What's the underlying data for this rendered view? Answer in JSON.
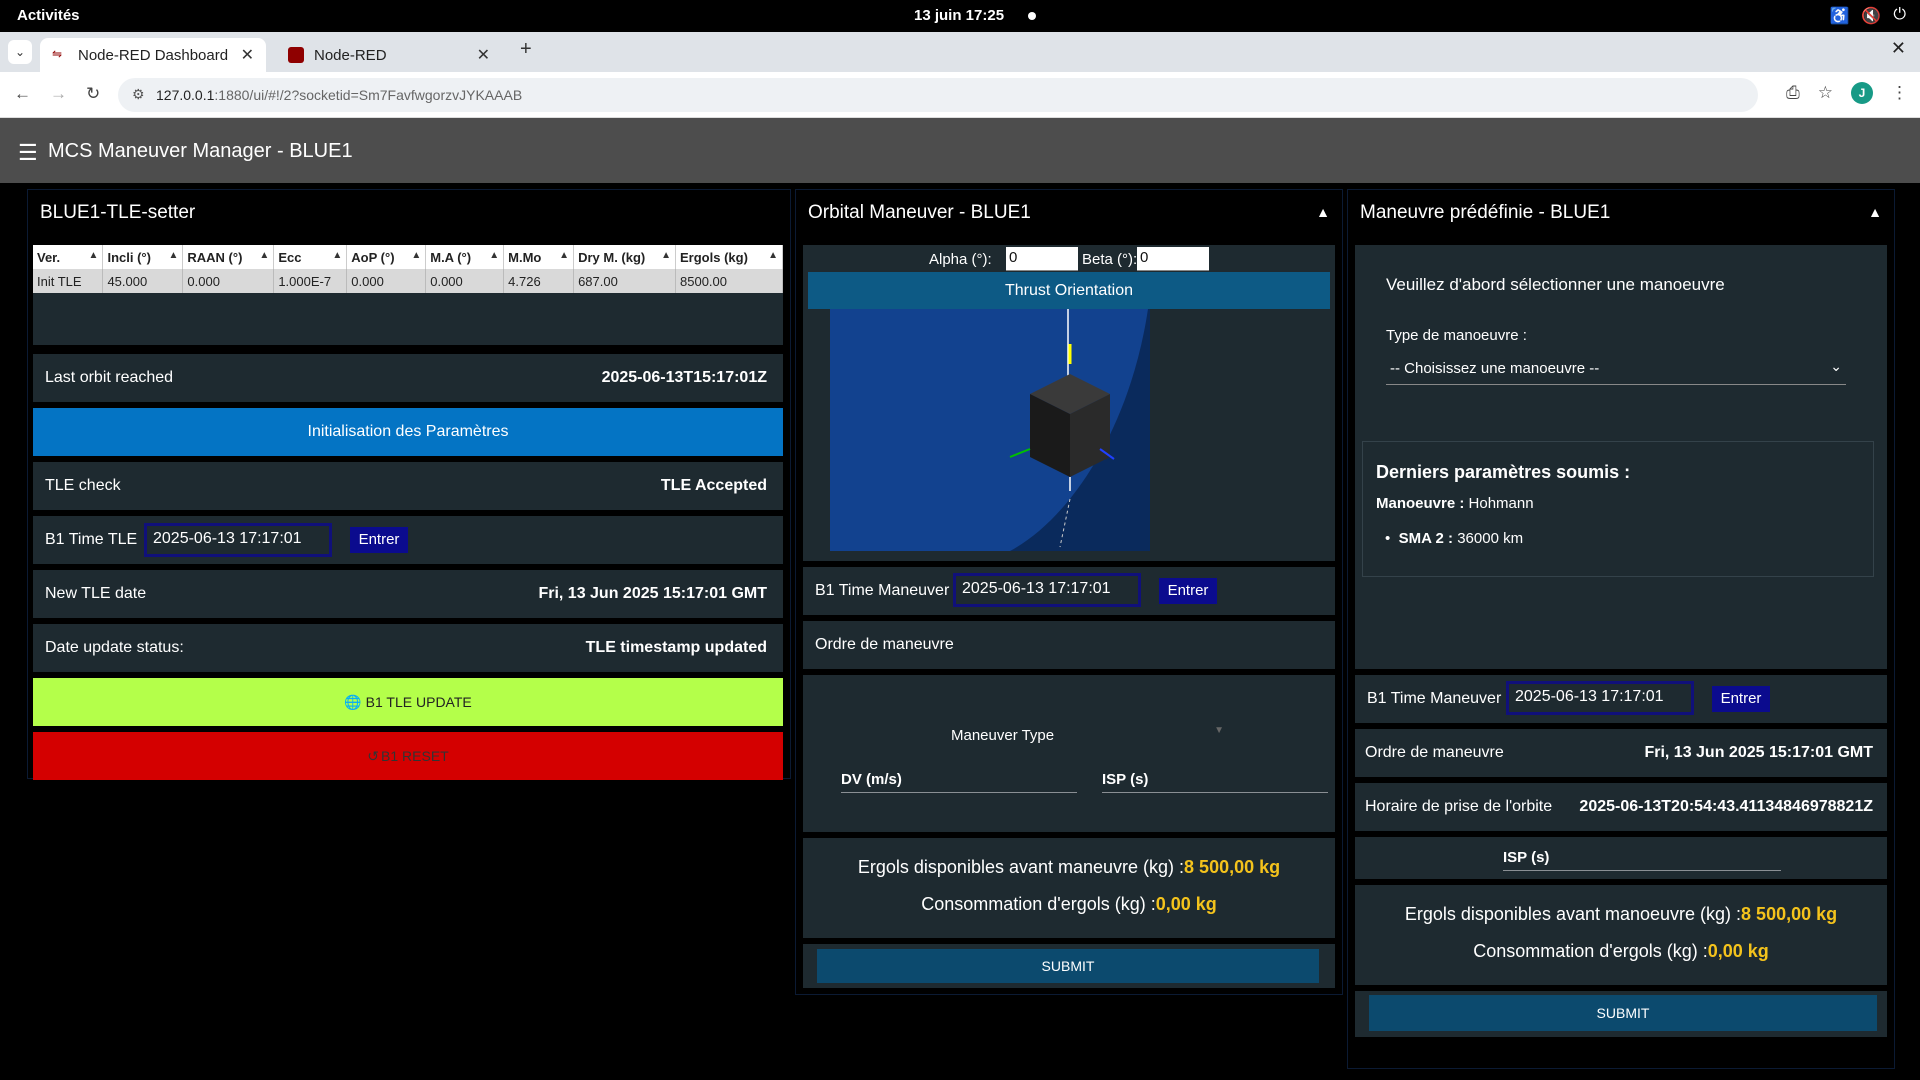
{
  "system": {
    "activities": "Activités",
    "clock": "13 juin  17:25"
  },
  "browser": {
    "tabs": [
      {
        "label": "Node-RED Dashboard",
        "active": true
      },
      {
        "label": "Node-RED",
        "active": false
      }
    ],
    "url_host": "127.0.0.1",
    "url_rest": ":1880/ui/#!/2?socketid=Sm7FavfwgorzvJYKAAAB",
    "profile_initial": "J"
  },
  "app": {
    "title": "MCS Maneuver Manager - BLUE1"
  },
  "tle_setter": {
    "title": "BLUE1-TLE-setter",
    "table": {
      "headers": [
        "Ver.",
        "Incli (°)",
        "RAAN (°)",
        "Ecc",
        "AoP (°)",
        "M.A (°)",
        "M.Mo",
        "Dry M. (kg)",
        "Ergols (kg)"
      ],
      "row": [
        "Init TLE",
        "45.000",
        "0.000",
        "1.000E-7",
        "0.000",
        "0.000",
        "4.726",
        "687.00",
        "8500.00"
      ]
    },
    "last_orbit_label": "Last orbit reached",
    "last_orbit_value": "2025-06-13T15:17:01Z",
    "init_button": "Initialisation des Paramètres",
    "tle_check_label": "TLE check",
    "tle_check_value": "TLE Accepted",
    "time_label": "B1 Time TLE",
    "time_value": "2025-06-13 17:17:01",
    "enter_label": "Entrer",
    "new_date_label": "New TLE date",
    "new_date_value": "Fri, 13 Jun 2025 15:17:01 GMT",
    "status_label": "Date update status:",
    "status_value": "TLE timestamp updated",
    "update_button": "B1 TLE UPDATE",
    "reset_button": "B1 RESET"
  },
  "orbital": {
    "title": "Orbital Maneuver - BLUE1",
    "alpha_label": "Alpha (°):",
    "alpha_value": "0",
    "beta_label": "Beta (°):",
    "beta_value": "0",
    "thrust_label": "Thrust Orientation",
    "time_label": "B1 Time Maneuver",
    "time_value": "2025-06-13 17:17:01",
    "enter_label": "Entrer",
    "order_label": "Ordre de maneuvre",
    "type_label": "Maneuver Type",
    "dv_label": "DV (m/s)",
    "isp_label": "ISP (s)",
    "ergols_label": "Ergols disponibles avant maneuvre (kg) :",
    "ergols_value": "8 500,00 kg",
    "conso_label": "Consommation d'ergols (kg) :",
    "conso_value": "0,00 kg",
    "submit": "SUBMIT"
  },
  "predefined": {
    "title": "Maneuvre prédéfinie - BLUE1",
    "prompt": "Veuillez d'abord sélectionner une manoeuvre",
    "type_label": "Type de manoeuvre :",
    "select_value": "-- Choisissez une manoeuvre --",
    "last_params_title": "Derniers paramètres soumis :",
    "maneuver_key": "Manoeuvre :",
    "maneuver_value": "Hohmann",
    "sma_key": "SMA 2 :",
    "sma_value": "36000 km",
    "time_label": "B1 Time Maneuver",
    "time_value": "2025-06-13 17:17:01",
    "enter_label": "Entrer",
    "order_label": "Ordre de maneuvre",
    "order_value": "Fri, 13 Jun 2025 15:17:01 GMT",
    "schedule_label": "Horaire de prise de l'orbite",
    "schedule_value": "2025-06-13T20:54:43.41134846978821Z",
    "isp_label": "ISP (s)",
    "ergols_label": "Ergols disponibles avant manoeuvre (kg) :",
    "ergols_value": "8 500,00 kg",
    "conso_label": "Consommation d'ergols (kg) :",
    "conso_value": "0,00 kg",
    "submit": "SUBMIT"
  },
  "colors": {
    "init_button": "#0474c4",
    "update_button": "#b4ff4a",
    "reset_button": "#d40000",
    "thrust_header": "#0d5a85",
    "highlight": "#f4c31c"
  }
}
